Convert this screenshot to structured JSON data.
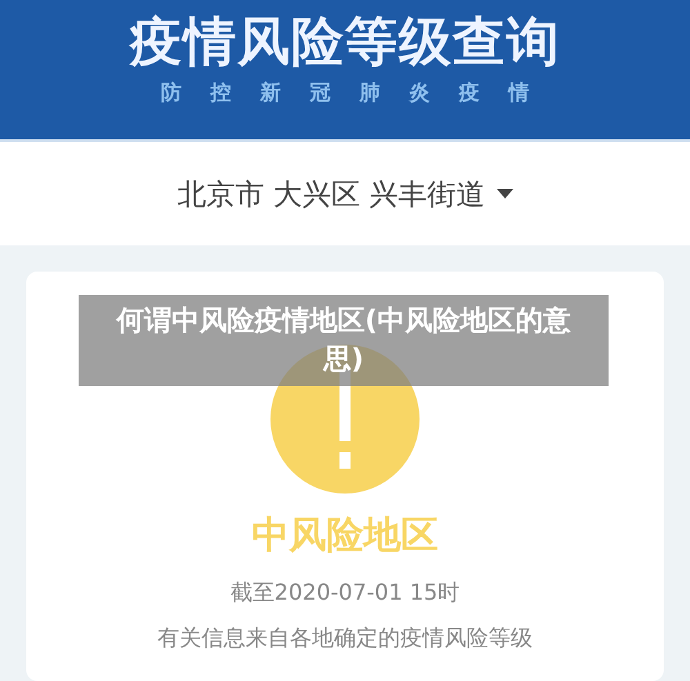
{
  "header": {
    "title": "疫情风险等级查询",
    "subtitle": [
      "防",
      "控",
      "新",
      "冠",
      "肺",
      "炎",
      "疫",
      "情"
    ]
  },
  "location": {
    "text": "北京市 大兴区 兴丰街道"
  },
  "result": {
    "color": "#f8d665",
    "label": "中风险地区",
    "as_of": "截至2020-07-01 15时",
    "note": "有关信息来自各地确定的疫情风险等级"
  },
  "caption": {
    "text": "何谓中风险疫情地区(中风险地区的意思)"
  }
}
